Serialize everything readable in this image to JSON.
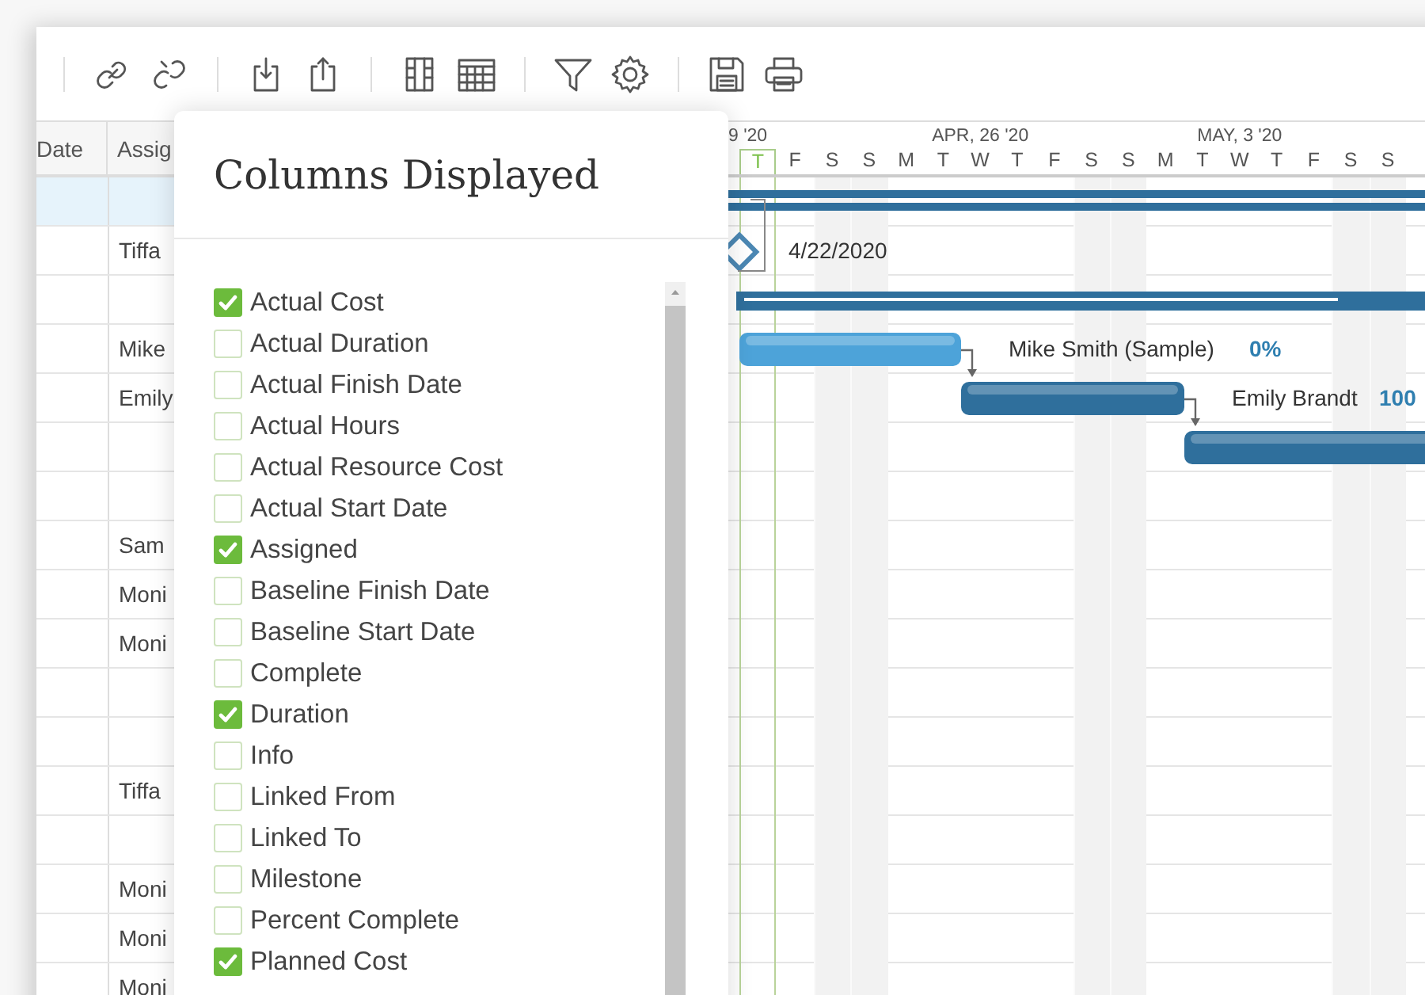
{
  "grid": {
    "columns": [
      "Date",
      "Assig"
    ],
    "rows": [
      {
        "selected": true
      },
      {
        "selected": false,
        "assigned": "Tiffa"
      },
      {
        "selected": false
      },
      {
        "selected": false,
        "assigned": "Mike"
      },
      {
        "selected": false,
        "assigned": "Emily"
      },
      {
        "selected": false
      },
      {
        "selected": false
      },
      {
        "selected": false,
        "assigned": "Sam"
      },
      {
        "selected": false,
        "assigned": "Moni"
      },
      {
        "selected": false,
        "assigned": "Moni"
      },
      {
        "selected": false
      },
      {
        "selected": false
      },
      {
        "selected": false,
        "assigned": "Tiffa"
      },
      {
        "selected": false
      },
      {
        "selected": false,
        "assigned": "Moni"
      },
      {
        "selected": false,
        "assigned": "Moni"
      },
      {
        "selected": false,
        "assigned": "Moni"
      }
    ]
  },
  "gantt": {
    "weeks": [
      "9 '20",
      "APR, 26 '20",
      "MAY, 3 '20"
    ],
    "days": [
      {
        "letter": "T",
        "today": true,
        "weekend": false
      },
      {
        "letter": "F",
        "today": false,
        "weekend": false
      },
      {
        "letter": "S",
        "today": false,
        "weekend": true
      },
      {
        "letter": "S",
        "today": false,
        "weekend": true
      },
      {
        "letter": "M",
        "today": false,
        "weekend": false
      },
      {
        "letter": "T",
        "today": false,
        "weekend": false
      },
      {
        "letter": "W",
        "today": false,
        "weekend": false
      },
      {
        "letter": "T",
        "today": false,
        "weekend": false
      },
      {
        "letter": "F",
        "today": false,
        "weekend": false
      },
      {
        "letter": "S",
        "today": false,
        "weekend": true
      },
      {
        "letter": "S",
        "today": false,
        "weekend": true
      },
      {
        "letter": "M",
        "today": false,
        "weekend": false
      },
      {
        "letter": "T",
        "today": false,
        "weekend": false
      },
      {
        "letter": "W",
        "today": false,
        "weekend": false
      },
      {
        "letter": "T",
        "today": false,
        "weekend": false
      },
      {
        "letter": "F",
        "today": false,
        "weekend": false
      },
      {
        "letter": "S",
        "today": false,
        "weekend": true
      },
      {
        "letter": "S",
        "today": false,
        "weekend": true
      }
    ],
    "bars": [
      {
        "kind": "summary"
      },
      {
        "kind": "milestone",
        "label": "4/22/2020"
      },
      {
        "kind": "summary-progress"
      },
      {
        "kind": "task",
        "color": "#4da3d9",
        "label": "Mike Smith (Sample)",
        "percent": "0%"
      },
      {
        "kind": "task",
        "color": "#2f6f9c",
        "label": "Emily Brandt",
        "percent": "100"
      },
      {
        "kind": "task",
        "color": "#2f6f9c"
      }
    ]
  },
  "popup": {
    "title": "Columns Displayed",
    "options": [
      {
        "label": "Actual Cost",
        "checked": true
      },
      {
        "label": "Actual Duration",
        "checked": false
      },
      {
        "label": "Actual Finish Date",
        "checked": false
      },
      {
        "label": "Actual Hours",
        "checked": false
      },
      {
        "label": "Actual Resource Cost",
        "checked": false
      },
      {
        "label": "Actual Start Date",
        "checked": false
      },
      {
        "label": "Assigned",
        "checked": true
      },
      {
        "label": "Baseline Finish Date",
        "checked": false
      },
      {
        "label": "Baseline Start Date",
        "checked": false
      },
      {
        "label": "Complete",
        "checked": false
      },
      {
        "label": "Duration",
        "checked": true
      },
      {
        "label": "Info",
        "checked": false
      },
      {
        "label": "Linked From",
        "checked": false
      },
      {
        "label": "Linked To",
        "checked": false
      },
      {
        "label": "Milestone",
        "checked": false
      },
      {
        "label": "Percent Complete",
        "checked": false
      },
      {
        "label": "Planned Cost",
        "checked": true
      }
    ]
  }
}
